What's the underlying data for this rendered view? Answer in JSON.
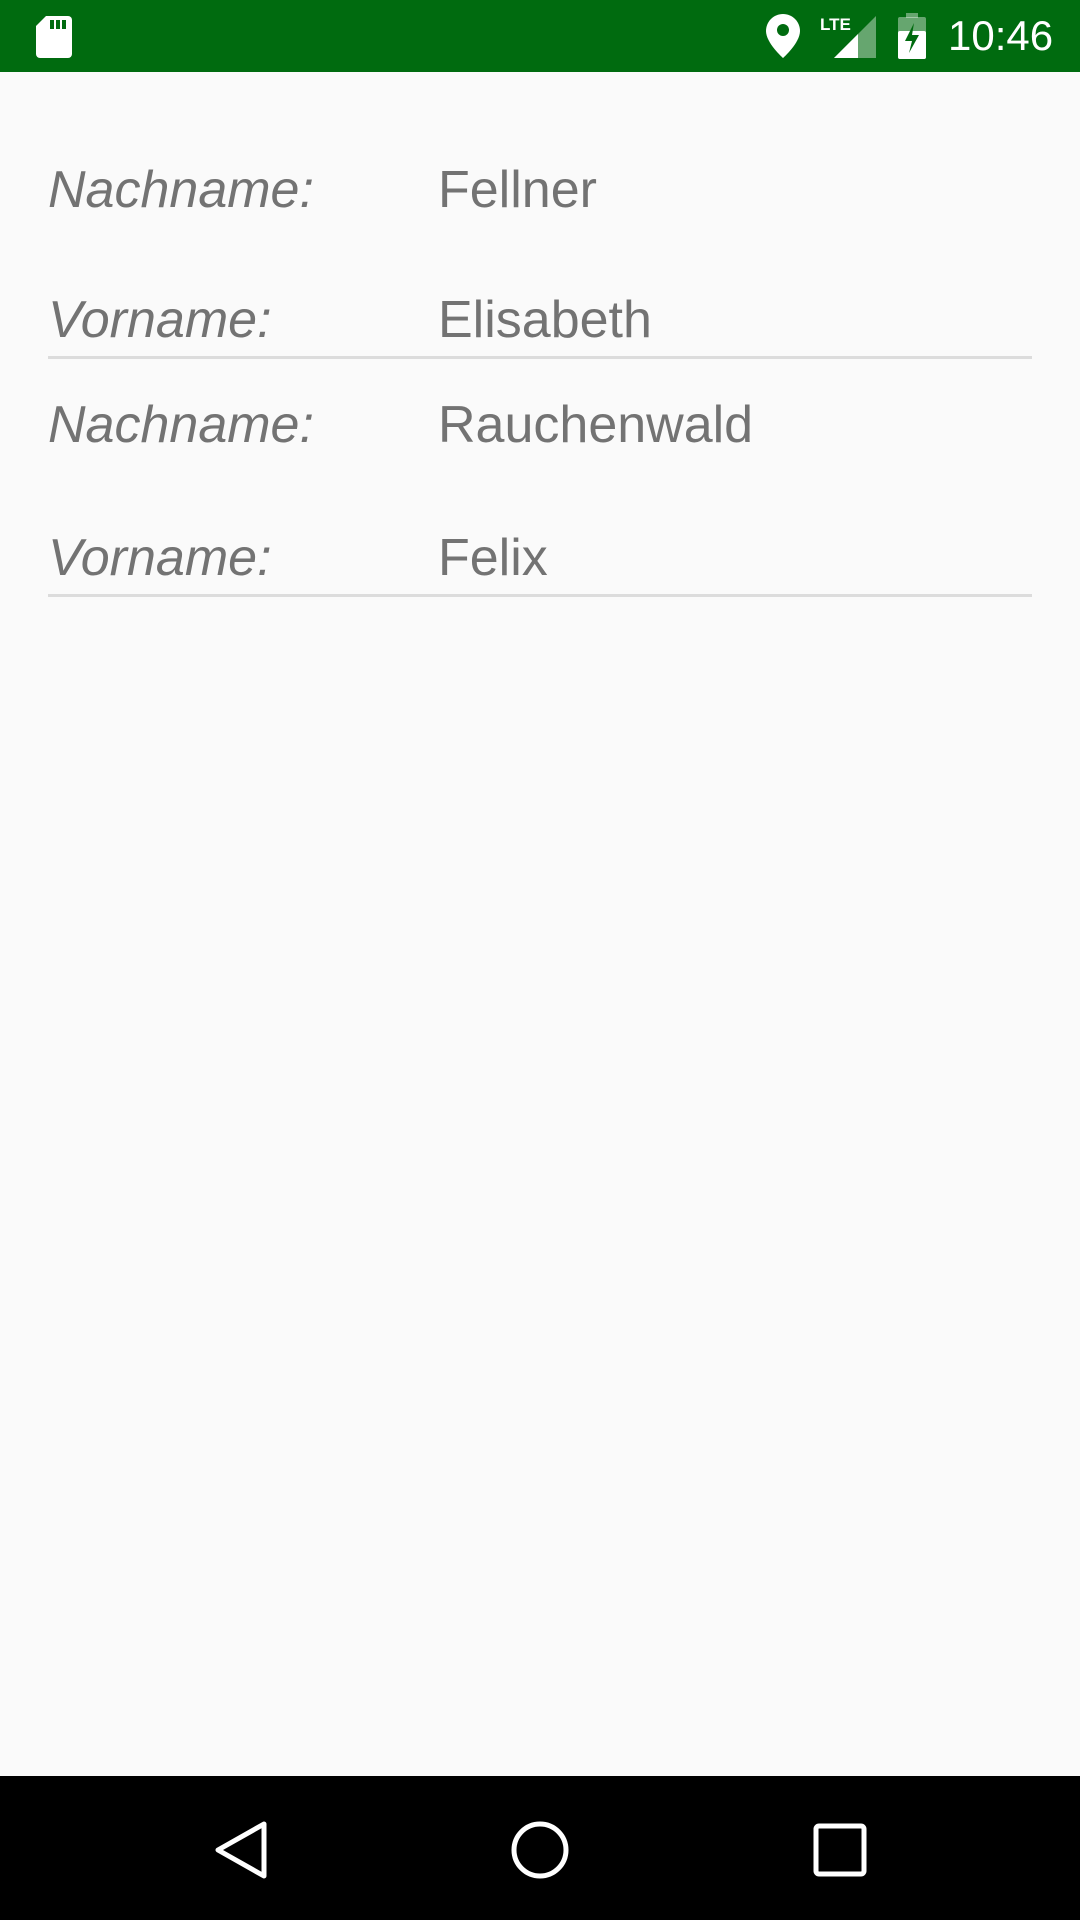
{
  "status_bar": {
    "time": "10:46",
    "network_label": "LTE",
    "background_color": "#006b0f",
    "icons": [
      "sd-card-icon",
      "location-icon",
      "lte-signal-icon",
      "battery-charging-icon"
    ]
  },
  "people": [
    {
      "last_name_label": "Nachname:",
      "last_name": "Fellner",
      "first_name_label": "Vorname:",
      "first_name": "Elisabeth"
    },
    {
      "last_name_label": "Nachname:",
      "last_name": "Rauchenwald",
      "first_name_label": "Vorname:",
      "first_name": "Felix"
    }
  ],
  "nav_bar": {
    "icons": [
      "back-icon",
      "home-icon",
      "recents-icon"
    ]
  },
  "colors": {
    "text": "#737373",
    "divider": "#dcdcdc",
    "background": "#fafafa"
  }
}
